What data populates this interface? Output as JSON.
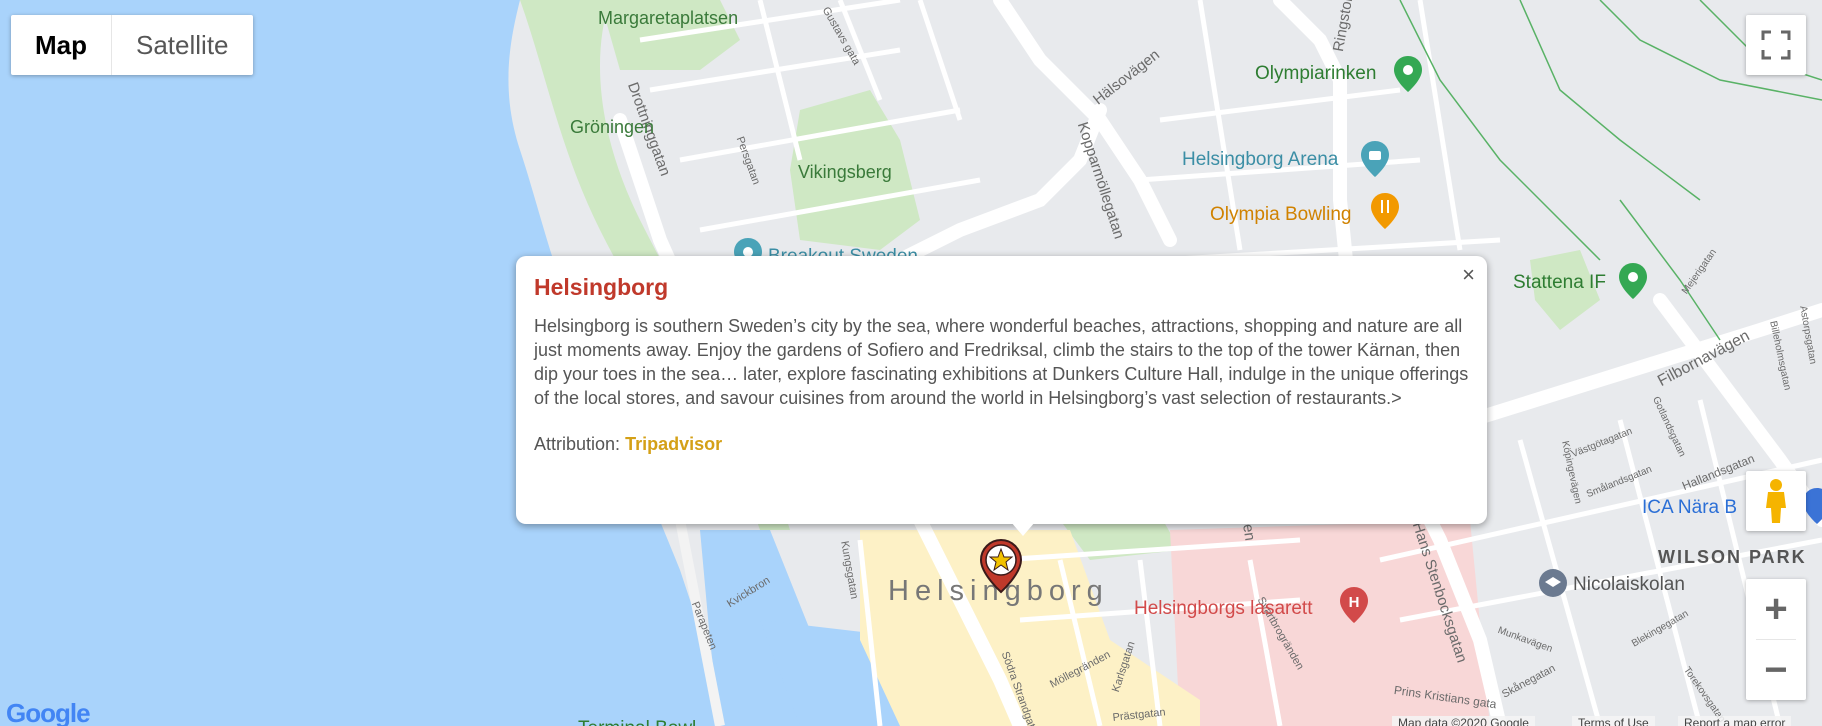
{
  "map_type": {
    "map": "Map",
    "satellite": "Satellite"
  },
  "labels": {
    "streets": [
      "Drottninggatan",
      "Persgatan",
      "Hälsovägen",
      "Kopparmöllegatan",
      "Filbornavägen",
      "Kungsgatan",
      "Kvickbron",
      "Parapeten",
      "Södra Strandgatan",
      "Möllegränden",
      "Karlsgatan",
      "Prästgatan",
      "Svartbrogränden",
      "Prins Kristians gata",
      "Munkavägen",
      "Skånegatan",
      "Blekingegatan",
      "Torekovsgatan",
      "Gotlandsgatan",
      "Västgötagatan",
      "Smålandsgatan",
      "Hallandsgatan",
      "Köpingevägen",
      "Billeholmsgatan",
      "Astorpsgatan",
      "Mejerigatan",
      "Ringstorpsvägen",
      "Ergalden",
      "Hans Stenbocksgatan",
      "Gustavs gata"
    ],
    "areas": [
      "Margaretaplatsen",
      "Gröningen",
      "Vikingsberg",
      "WILSON PARK"
    ],
    "pois": [
      "Olympiarinken",
      "Helsingborg Arena",
      "Olympia Bowling",
      "Stattena IF",
      "Breakout Sweden",
      "ICA Nära B",
      "Nicolaiskolan",
      "Helsingborgs lasarett",
      "Terminal Bowl"
    ],
    "city": "Helsingborg"
  },
  "popup": {
    "title": "Helsingborg",
    "body": "Helsingborg is southern Sweden’s city by the sea, where wonderful beaches, attractions, shopping and nature are all just moments away. Enjoy the gardens of Sofiero and Fredriksal, climb the stairs to the top of the tower Kärnan, then dip your toes in the sea… later, explore fascinating exhibitions at Dunkers Culture Hall, indulge in the unique offerings of the local stores, and savour cuisines from around the world in Helsingborg’s vast selection of restaurants.>",
    "attribution_label": "Attribution:",
    "attribution_link": "Tripadvisor",
    "close": "×"
  },
  "controls": {
    "zoom_in": "+",
    "zoom_out": "−"
  },
  "footer": {
    "map_data": "Map data ©2020 Google",
    "terms": "Terms of Use",
    "report": "Report a map error"
  },
  "logo": "Google",
  "colors": {
    "water": "#a9d3fb",
    "park": "#cfe8c4",
    "poi_green": "#34a853",
    "poi_teal": "#4aa3b8",
    "poi_orange": "#f29900",
    "hospital_red": "#d24a4a",
    "title": "#c0392b",
    "attribution": "#d4a017"
  }
}
